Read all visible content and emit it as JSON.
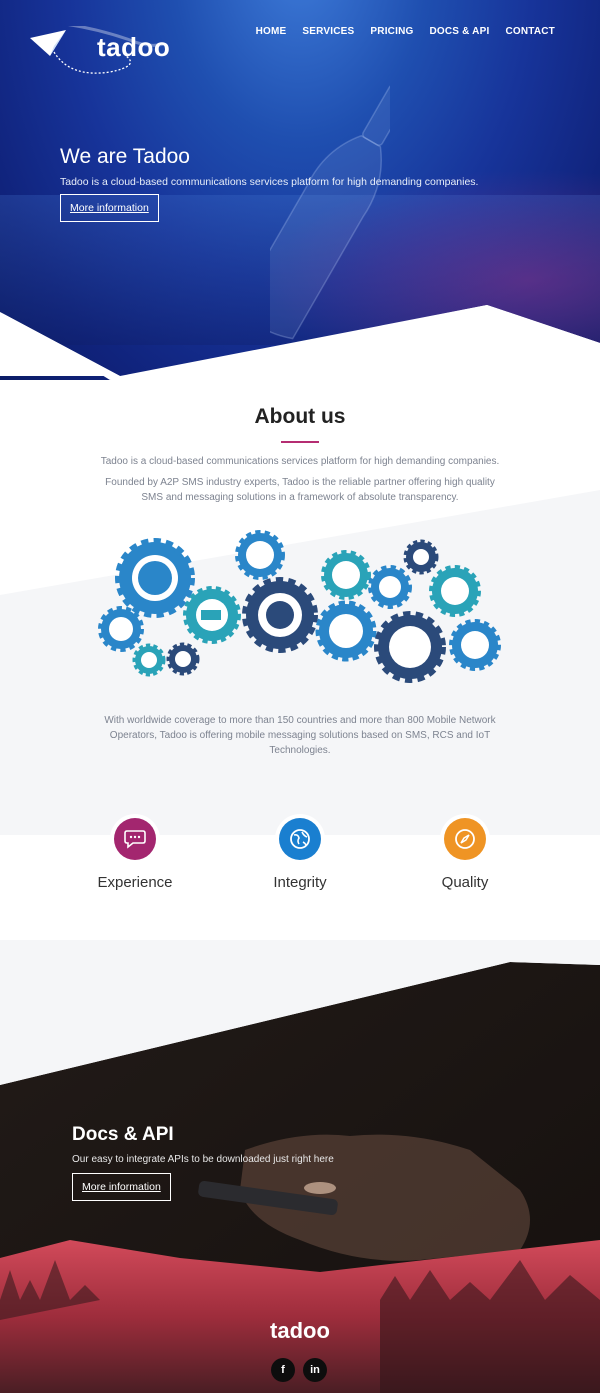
{
  "brand": {
    "name": "tadoo"
  },
  "nav": [
    {
      "label": "HOME"
    },
    {
      "label": "SERVICES"
    },
    {
      "label": "PRICING"
    },
    {
      "label": "DOCS & API"
    },
    {
      "label": "CONTACT"
    }
  ],
  "hero": {
    "title": "We are Tadoo",
    "text": "Tadoo is a cloud-based communications services platform for high demanding companies.",
    "button": "More information"
  },
  "about": {
    "title": "About us",
    "p1": "Tadoo is a cloud-based communications services platform for high demanding companies.",
    "p2": "Founded by A2P SMS industry experts, Tadoo is the reliable partner offering high quality SMS and messaging solutions in a framework of absolute transparency.",
    "p3": "With worldwide coverage to more than 150 countries and more than 800 Mobile Network Operators, Tadoo is offering mobile messaging solutions based on SMS, RCS and IoT Technologies."
  },
  "values": [
    {
      "label": "Experience",
      "color": "#a3266f",
      "icon": "chat-icon"
    },
    {
      "label": "Integrity",
      "color": "#1a7fd0",
      "icon": "globe-icon"
    },
    {
      "label": "Quality",
      "color": "#ef9424",
      "icon": "compass-icon"
    }
  ],
  "docs": {
    "title": "Docs & API",
    "text": "Our easy to integrate APIs to be downloaded just right here",
    "button": "More information"
  },
  "footer": {
    "brand": "tadoo",
    "social": [
      {
        "label": "f",
        "icon": "facebook-icon"
      },
      {
        "label": "in",
        "icon": "linkedin-icon"
      }
    ]
  },
  "colors": {
    "accent": "#b52d72",
    "hero_blue": "#17349a",
    "gear_dark": "#2b4a7a",
    "gear_blue": "#2a86c9",
    "gear_teal": "#2aa3b8"
  }
}
